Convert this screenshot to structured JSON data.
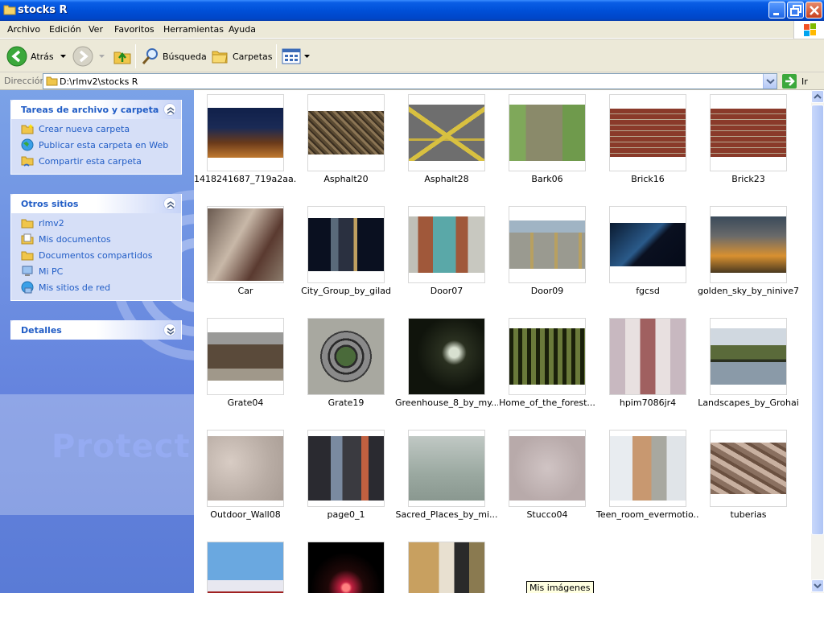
{
  "window": {
    "title": "stocks R"
  },
  "menu": [
    "Archivo",
    "Edición",
    "Ver",
    "Favoritos",
    "Herramientas",
    "Ayuda"
  ],
  "toolbar": {
    "back_label": "Atrás",
    "search_label": "Búsqueda",
    "folders_label": "Carpetas"
  },
  "address": {
    "label": "Dirección",
    "path": "D:\\rlmv2\\stocks R",
    "go_label": "Ir"
  },
  "tasks": {
    "title": "Tareas de archivo y carpeta",
    "items": [
      "Crear nueva carpeta",
      "Publicar esta carpeta en Web",
      "Compartir esta carpeta"
    ]
  },
  "other_places": {
    "title": "Otros sitios",
    "items": [
      "rlmv2",
      "Mis documentos",
      "Documentos compartidos",
      "Mi PC",
      "Mis sitios de red"
    ]
  },
  "details": {
    "title": "Detalles"
  },
  "watermark": {
    "text": "Protect"
  },
  "files": [
    {
      "name": "1418241687_719a2aa...",
      "icon": "night-street-thumbnail"
    },
    {
      "name": "Asphalt20",
      "icon": "asphalt-thumbnail"
    },
    {
      "name": "Asphalt28",
      "icon": "road-marking-thumbnail"
    },
    {
      "name": "Bark06",
      "icon": "tree-bark-thumbnail"
    },
    {
      "name": "Brick16",
      "icon": "brick-wall-thumbnail"
    },
    {
      "name": "Brick23",
      "icon": "brick-wall-thumbnail"
    },
    {
      "name": "Car",
      "icon": "wrecked-car-thumbnail"
    },
    {
      "name": "City_Group_by_gilad",
      "icon": "city-night-thumbnail"
    },
    {
      "name": "Door07",
      "icon": "door-thumbnail"
    },
    {
      "name": "Door09",
      "icon": "garage-doors-thumbnail"
    },
    {
      "name": "fgcsd",
      "icon": "dark-blue-thumbnail"
    },
    {
      "name": "golden_sky_by_ninive7",
      "icon": "golden-sky-thumbnail"
    },
    {
      "name": "Grate04",
      "icon": "grate-thumbnail"
    },
    {
      "name": "Grate19",
      "icon": "manhole-thumbnail"
    },
    {
      "name": "Greenhouse_8_by_my...",
      "icon": "greenhouse-thumbnail"
    },
    {
      "name": "Home_of_the_forest...",
      "icon": "forest-thumbnail"
    },
    {
      "name": "hpim7086jr4",
      "icon": "cathedral-thumbnail"
    },
    {
      "name": "Landscapes_by_Grohai",
      "icon": "lake-landscape-thumbnail"
    },
    {
      "name": "Outdoor_Wall08",
      "icon": "stucco-wall-thumbnail"
    },
    {
      "name": "page0_1",
      "icon": "city-buildings-thumbnail"
    },
    {
      "name": "Sacred_Places_by_mi...",
      "icon": "misty-place-thumbnail"
    },
    {
      "name": "Stucco04",
      "icon": "stucco-thumbnail"
    },
    {
      "name": "Teen_room_evermotio...",
      "icon": "room-interior-thumbnail"
    },
    {
      "name": "tuberias",
      "icon": "pipes-thumbnail"
    },
    {
      "name": "",
      "icon": "temple-sky-thumbnail"
    },
    {
      "name": "",
      "icon": "fireworks-thumbnail"
    },
    {
      "name": "",
      "icon": "couple-photo-thumbnail"
    }
  ],
  "tooltip": "Mis imágenes"
}
